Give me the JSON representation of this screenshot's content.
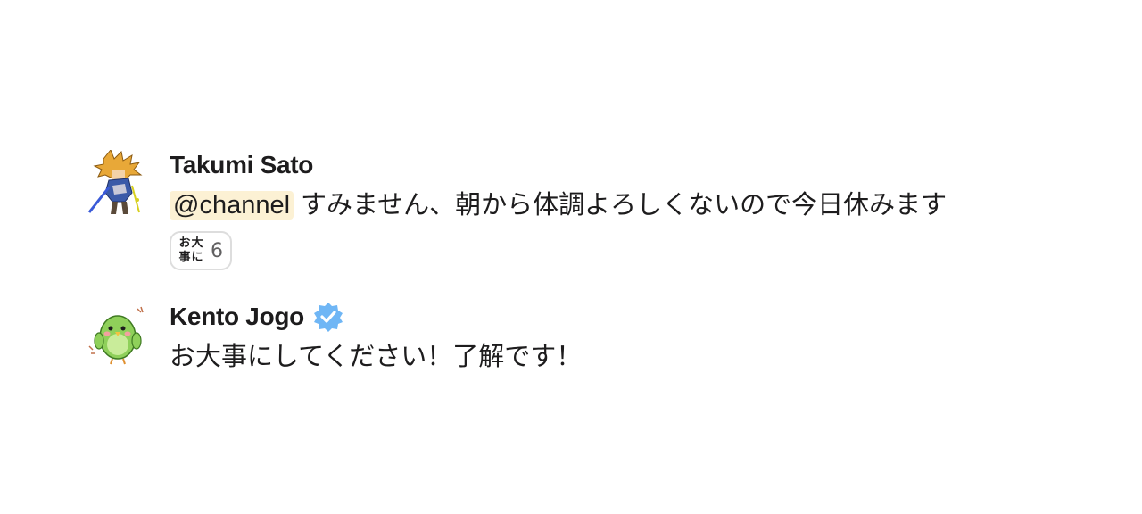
{
  "messages": [
    {
      "username": "Takumi Sato",
      "mention": "@channel",
      "text": "すみません、朝から体調よろしくないので今日休みます",
      "avatar_icon": "anime-warrior-avatar",
      "reaction": {
        "emoji_icon": "odaijini-custom-emoji",
        "emoji_chars": [
          "お",
          "大",
          "事",
          "に"
        ],
        "count": "6"
      }
    },
    {
      "username": "Kento Jogo",
      "verified_icon": "verified-badge-icon",
      "text": "お大事にしてください！了解です！",
      "avatar_icon": "green-bird-avatar"
    }
  ],
  "colors": {
    "mention_bg": "#fcf1d4",
    "verified": "#6fb6f5",
    "reaction_border": "#dddddd"
  }
}
